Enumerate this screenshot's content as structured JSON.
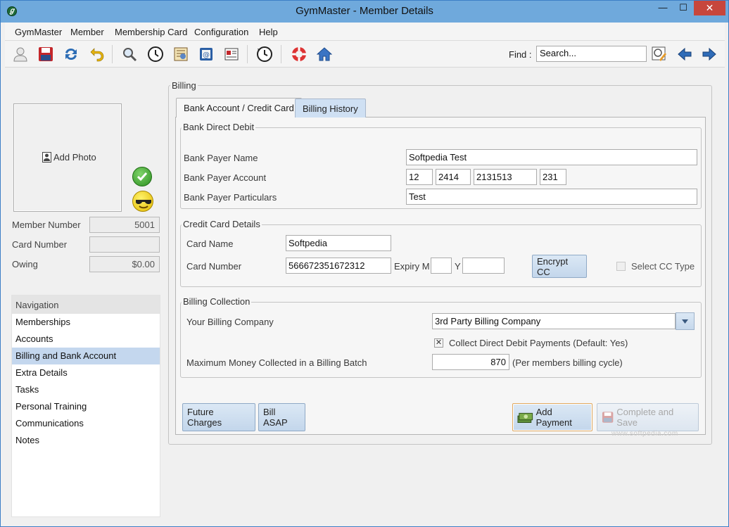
{
  "window": {
    "title": "GymMaster - Member Details",
    "min_glyph": "—",
    "max_glyph": "☐",
    "close_glyph": "✕"
  },
  "menu": [
    {
      "label": "GymMaster"
    },
    {
      "label": "Member"
    },
    {
      "label": "Membership Card"
    },
    {
      "label": "Configuration"
    },
    {
      "label": "Help"
    }
  ],
  "toolbar": {
    "find_label": "Find :",
    "search_value": "Search...",
    "icons": [
      "user-icon",
      "save-icon",
      "refresh-icon",
      "undo-icon",
      "search-icon",
      "clock-icon",
      "badge-icon",
      "address-card-icon",
      "id-card-icon",
      "history-clock-icon",
      "lifebuoy-icon",
      "home-icon",
      "edit-search-icon",
      "arrow-left-icon",
      "arrow-right-icon"
    ]
  },
  "member": {
    "add_photo": "Add Photo",
    "member_number_label": "Member Number",
    "member_number": "5001",
    "card_number_label": "Card Number",
    "card_number": "",
    "owing_label": "Owing",
    "owing": "$0.00"
  },
  "navigation": {
    "header": "Navigation",
    "items": [
      "Memberships",
      "Accounts",
      "Billing and Bank Account",
      "Extra Details",
      "Tasks",
      "Personal Training",
      "Communications",
      "Notes"
    ],
    "active_index": 2
  },
  "billing": {
    "group_title": "Billing",
    "tabs": [
      "Bank Account / Credit Card",
      "Billing History"
    ],
    "bank": {
      "title": "Bank Direct Debit",
      "payer_name_label": "Bank Payer Name",
      "payer_name": "Softpedia Test",
      "payer_account_label": "Bank Payer Account",
      "account_parts": [
        "12",
        "2414",
        "2131513",
        "231"
      ],
      "particulars_label": "Bank Payer Particulars",
      "particulars": "Test"
    },
    "card": {
      "title": "Credit Card Details",
      "name_label": "Card Name",
      "name": "Softpedia",
      "number_label": "Card Number",
      "number": "566672351672312",
      "expiry_m_label": "Expiry M",
      "expiry_m": "",
      "expiry_y_label": "Y",
      "expiry_y": "",
      "encrypt_label": "Encrypt CC",
      "select_type_label": "Select CC Type"
    },
    "collection": {
      "title": "Billing Collection",
      "company_label": "Your Billing Company",
      "company": "3rd Party Billing Company",
      "collect_label": "Collect Direct Debit Payments (Default: Yes)",
      "collect_checked": true,
      "max_label": "Maximum Money Collected in a Billing Batch",
      "max_value": "870",
      "max_suffix": "(Per members billing cycle)"
    },
    "buttons": {
      "future_charges": "Future Charges",
      "bill_asap": "Bill ASAP",
      "add_payment": "Add Payment",
      "complete_save": "Complete and Save"
    }
  },
  "watermark": "www.softpedia.com",
  "colors": {
    "titlebar": "#6fa9dc",
    "nav_active": "#c4d7ee",
    "close_button": "#c7463c"
  }
}
